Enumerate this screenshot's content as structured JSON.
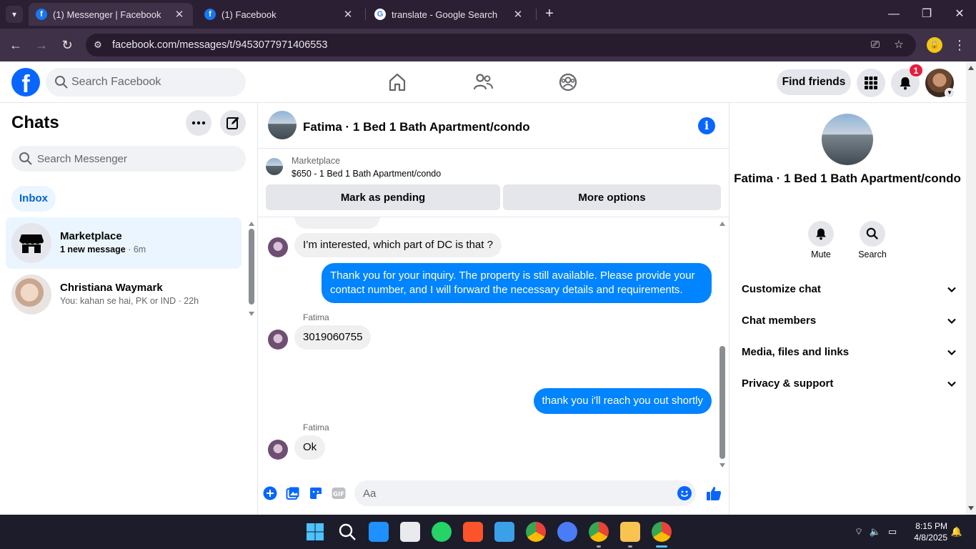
{
  "browser": {
    "tabs": [
      {
        "title": "(1) Messenger | Facebook",
        "favicon": "facebook-icon",
        "active": true
      },
      {
        "title": "(1) Facebook",
        "favicon": "facebook-icon",
        "active": false
      },
      {
        "title": "translate - Google Search",
        "favicon": "google-icon",
        "active": false
      }
    ],
    "url": "facebook.com/messages/t/9453077971406553"
  },
  "fb": {
    "search_placeholder": "Search Facebook",
    "find_friends": "Find friends",
    "notification_count": "1"
  },
  "chats": {
    "title": "Chats",
    "search_placeholder": "Search Messenger",
    "filter": "Inbox",
    "items": [
      {
        "name": "Marketplace",
        "preview": "1 new message",
        "time": "6m"
      },
      {
        "name": "Christiana Waymark",
        "preview": "You: kahan se hai, PK or IND",
        "time": "22h"
      }
    ]
  },
  "conversation": {
    "title": "Fatima · 1 Bed 1 Bath Apartment/condo",
    "marketplace_label": "Marketplace",
    "listing": "$650 - 1 Bed 1 Bath Apartment/condo",
    "mark_pending": "Mark as pending",
    "more_options": "More options",
    "messages": [
      {
        "from": "them",
        "text": "I’m interested, which part of DC is that ?"
      },
      {
        "from": "me",
        "text": "Thank you for your inquiry. The property is still available. Please provide your contact number, and I will forward the necessary details and requirements."
      },
      {
        "from": "them",
        "sender": "Fatima",
        "text": "3019060755"
      },
      {
        "from": "me",
        "text": "thank you i'll reach you out shortly"
      },
      {
        "from": "them",
        "sender": "Fatima",
        "text": "Ok"
      }
    ],
    "composer_placeholder": "Aa"
  },
  "info_panel": {
    "name": "Fatima · 1 Bed 1 Bath Apartment/condo",
    "actions": [
      "Mute",
      "Search"
    ],
    "sections": [
      "Customize chat",
      "Chat members",
      "Media, files and links",
      "Privacy & support"
    ]
  },
  "taskbar": {
    "time": "8:15 PM",
    "date": "4/8/2025"
  },
  "colors": {
    "fb_blue": "#0866ff",
    "bubble_out": "#0084ff",
    "chrome_dark": "#2b1f33"
  }
}
